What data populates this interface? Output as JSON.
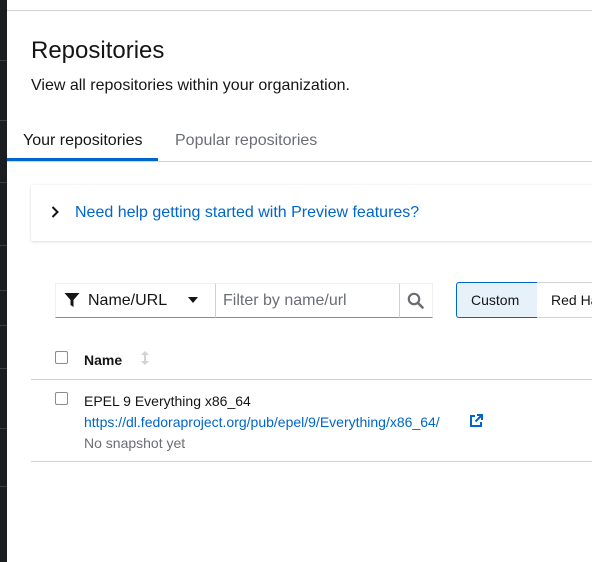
{
  "page": {
    "title": "Repositories",
    "subtitle": "View all repositories within your organization."
  },
  "tabs": [
    {
      "label": "Your repositories",
      "active": true
    },
    {
      "label": "Popular repositories",
      "active": false
    }
  ],
  "help_card": {
    "text": "Need help getting started with Preview features?",
    "expanded": false
  },
  "filter": {
    "attribute": "Name/URL",
    "placeholder": "Filter by name/url",
    "value": ""
  },
  "origin_toggle": {
    "options": [
      "Custom",
      "Red Ha"
    ],
    "selected": "Custom"
  },
  "table": {
    "columns": [
      "Name"
    ],
    "rows": [
      {
        "name": "EPEL 9 Everything x86_64",
        "url": "https://dl.fedoraproject.org/pub/epel/9/Everything/x86_64/",
        "status": "No snapshot yet",
        "checked": false
      }
    ]
  },
  "colors": {
    "accent": "#0066cc",
    "border": "#d2d2d2",
    "muted_text": "#6a6e73",
    "selected_toggle_bg": "#e7f1fa"
  }
}
